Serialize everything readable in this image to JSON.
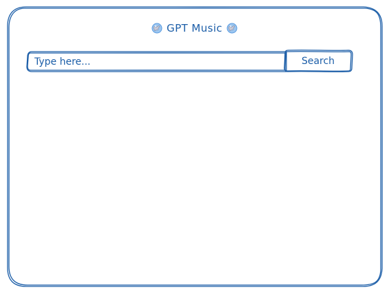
{
  "app": {
    "title": "GPT Music"
  },
  "search": {
    "placeholder": "Type here...",
    "value": "",
    "button_label": "Search"
  },
  "colors": {
    "stroke": "#1c5ea8",
    "globe": "#5a9be0"
  },
  "icons": {
    "title_left": "globe-icon",
    "title_right": "globe-icon"
  }
}
